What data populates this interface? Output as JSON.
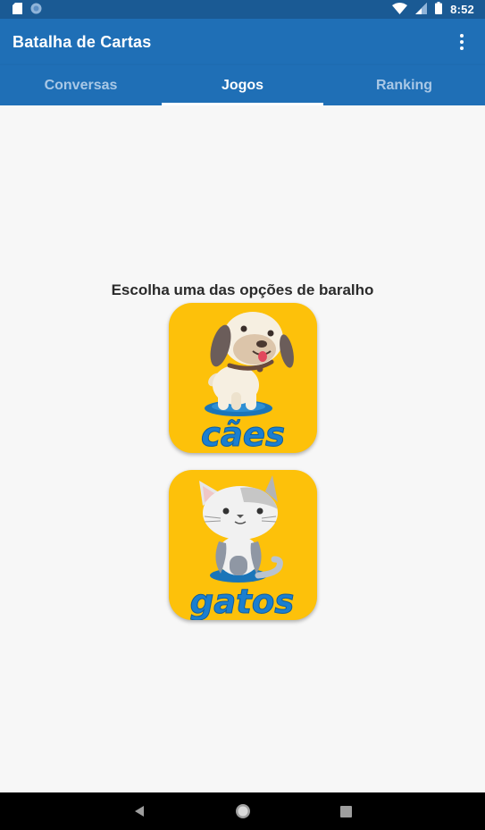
{
  "status_bar": {
    "time": "8:52",
    "icons": [
      "sd-card-icon",
      "sync-icon",
      "wifi-icon",
      "signal-icon",
      "battery-icon"
    ]
  },
  "app_bar": {
    "title": "Batalha de Cartas",
    "overflow_icon": "more-vert-icon"
  },
  "tabs": [
    {
      "label": "Conversas",
      "active": false
    },
    {
      "label": "Jogos",
      "active": true
    },
    {
      "label": "Ranking",
      "active": false
    }
  ],
  "main": {
    "prompt": "Escolha uma das opções de baralho",
    "decks": [
      {
        "label": "cães",
        "icon": "dog-icon"
      },
      {
        "label": "gatos",
        "icon": "cat-icon"
      }
    ]
  },
  "nav_bar": {
    "icons": [
      "back-icon",
      "home-icon",
      "recents-icon"
    ]
  },
  "colors": {
    "status_bar": "#1a5a94",
    "primary": "#1f6fb6",
    "tab_inactive": "#a9c8e6",
    "deck_background": "#fdc10a",
    "deck_text": "#1b7fd0"
  }
}
